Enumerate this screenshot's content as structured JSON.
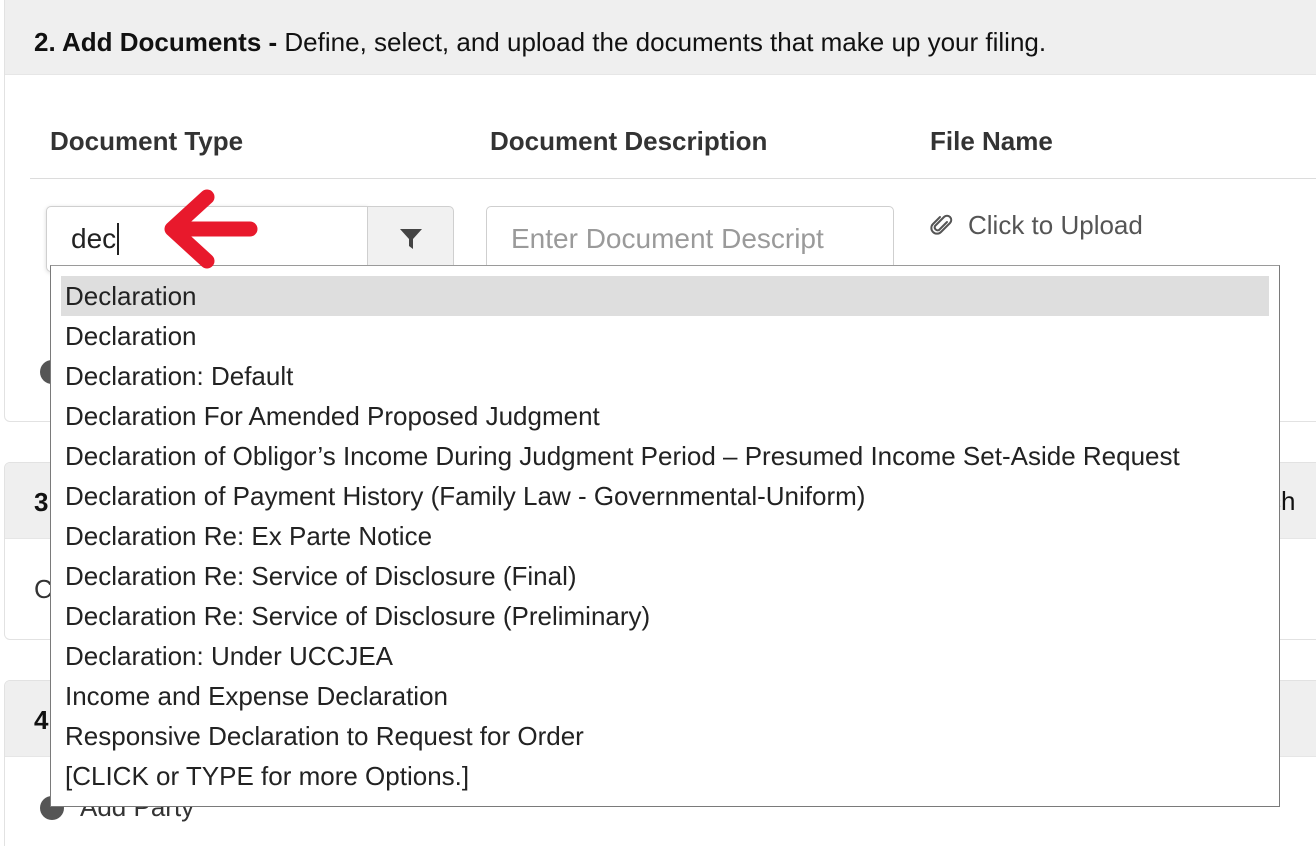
{
  "section2": {
    "number": "2. Add Documents -",
    "description": "Define, select, and upload the documents that make up your filing.",
    "columns": {
      "document_type": "Document Type",
      "document_description": "Document Description",
      "file_name": "File Name"
    },
    "document_type_value": "dec",
    "document_description_placeholder": "Enter Document Descript",
    "upload_label": "Click to Upload"
  },
  "dropdown": {
    "items": [
      "Declaration",
      "Declaration",
      "Declaration: Default",
      "Declaration For Amended Proposed Judgment",
      "Declaration of Obligor’s Income During Judgment Period – Presumed Income Set-Aside Request",
      "Declaration of Payment History (Family Law - Governmental-Uniform)",
      "Declaration Re: Ex Parte Notice",
      "Declaration Re: Service of Disclosure (Final)",
      "Declaration Re: Service of Disclosure (Preliminary)",
      "Declaration: Under UCCJEA",
      "Income and Expense Declaration",
      "Responsive Declaration to Request for Order",
      "[CLICK or TYPE for more Options.]"
    ],
    "highlighted_index": 0
  },
  "behind": {
    "section3_number": "3",
    "section3_right": "ch",
    "section3_body": "C",
    "section4_number": "4",
    "add_party": "Add Party"
  },
  "annotation": {
    "arrow_color": "#e8192c"
  }
}
